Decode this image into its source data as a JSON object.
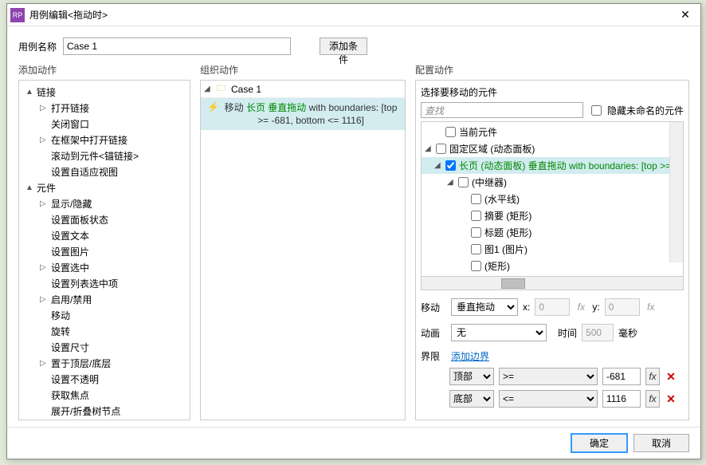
{
  "title": "用例编辑<拖动时>",
  "case_name_label": "用例名称",
  "case_name_value": "Case 1",
  "add_condition_btn": "添加条件",
  "col_headers": {
    "actions": "添加动作",
    "org": "组织动作",
    "conf": "配置动作"
  },
  "action_tree": [
    {
      "label": "链接",
      "expand": "▲",
      "children": [
        {
          "label": "打开链接",
          "expand": "▷"
        },
        {
          "label": "关闭窗口"
        },
        {
          "label": "在框架中打开链接",
          "expand": "▷"
        },
        {
          "label": "滚动到元件<锚链接>"
        },
        {
          "label": "设置自适应视图"
        }
      ]
    },
    {
      "label": "元件",
      "expand": "▲",
      "children": [
        {
          "label": "显示/隐藏",
          "expand": "▷"
        },
        {
          "label": "设置面板状态"
        },
        {
          "label": "设置文本"
        },
        {
          "label": "设置图片"
        },
        {
          "label": "设置选中",
          "expand": "▷"
        },
        {
          "label": "设置列表选中项"
        },
        {
          "label": "启用/禁用",
          "expand": "▷"
        },
        {
          "label": "移动"
        },
        {
          "label": "旋转"
        },
        {
          "label": "设置尺寸"
        },
        {
          "label": "置于顶层/底层",
          "expand": "▷"
        },
        {
          "label": "设置不透明"
        },
        {
          "label": "获取焦点"
        },
        {
          "label": "展开/折叠树节点"
        }
      ]
    }
  ],
  "org": {
    "case_label": "Case 1",
    "move_label": "移动",
    "widget_label": "长页",
    "rest1": "垂直拖动",
    "rest2": "with boundaries: [top >= -681, bottom <= 1116]"
  },
  "conf": {
    "select_widget_label": "选择要移动的元件",
    "search_placeholder": "查找",
    "hide_unnamed_label": "隐藏未命名的元件",
    "widget_rows": [
      {
        "indent": 1,
        "tw": "",
        "checked": false,
        "label": "当前元件"
      },
      {
        "indent": 0,
        "tw": "◢",
        "checked": false,
        "label": "固定区域 (动态面板)"
      },
      {
        "indent": 1,
        "tw": "◢",
        "checked": true,
        "selected": true,
        "green_label": "长页 (动态面板)",
        "green_rest": "垂直拖动 with boundaries: [top >= -"
      },
      {
        "indent": 2,
        "tw": "◢",
        "checked": false,
        "label": "(中继器)"
      },
      {
        "indent": 3,
        "tw": "",
        "checked": false,
        "label": "(水平线)"
      },
      {
        "indent": 3,
        "tw": "",
        "checked": false,
        "label": "摘要 (矩形)"
      },
      {
        "indent": 3,
        "tw": "",
        "checked": false,
        "label": "标题 (矩形)"
      },
      {
        "indent": 3,
        "tw": "",
        "checked": false,
        "label": "图1 (图片)"
      },
      {
        "indent": 3,
        "tw": "",
        "checked": false,
        "label": "(矩形)"
      },
      {
        "indent": 3,
        "tw": "",
        "checked": false,
        "label": "(矩形)",
        "dim": true
      }
    ],
    "move_label": "移动",
    "move_mode": "垂直拖动",
    "x_label": "x:",
    "x_value": "0",
    "y_label": "y:",
    "y_value": "0",
    "fx_label": "fx",
    "anim_label": "动画",
    "anim_value": "无",
    "time_label": "时间",
    "time_value": "500",
    "time_unit": "毫秒",
    "bounds_label": "界限",
    "add_bounds_link": "添加边界",
    "bounds": [
      {
        "pos": "顶部",
        "op": ">=",
        "val": "-681"
      },
      {
        "pos": "底部",
        "op": "<=",
        "val": "1116"
      }
    ]
  },
  "buttons": {
    "ok": "确定",
    "cancel": "取消"
  }
}
